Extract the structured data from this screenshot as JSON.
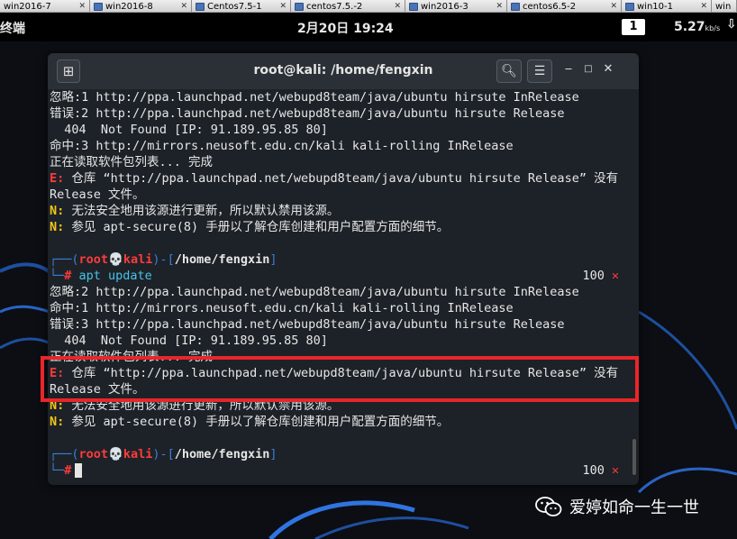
{
  "vm_tabs": [
    {
      "label": "win2016-7"
    },
    {
      "label": "win2016-8"
    },
    {
      "label": "Centos7.5-1"
    },
    {
      "label": "centos7.5.-2"
    },
    {
      "label": "win2016-3"
    },
    {
      "label": "centos6.5-2"
    },
    {
      "label": "win10-1"
    },
    {
      "label": "win"
    }
  ],
  "topbar": {
    "app_name": "终端",
    "clock": "2月20日 19:24",
    "workspace": "1",
    "net_speed": "5.27",
    "net_unit": "kb/s"
  },
  "terminal": {
    "title": "root@kali: /home/fengxin",
    "icons": {
      "new_tab": "plus-box-icon",
      "search": "search-icon",
      "menu": "hamburger-menu-icon",
      "minimize": "minimize-icon",
      "maximize": "maximize-icon",
      "close": "close-icon"
    },
    "block1": {
      "l1": "忽略:1 http://ppa.launchpad.net/webupd8team/java/ubuntu hirsute InRelease",
      "l2": "错误:2 http://ppa.launchpad.net/webupd8team/java/ubuntu hirsute Release",
      "l3": "  404  Not Found [IP: 91.189.95.85 80]",
      "l4": "命中:3 http://mirrors.neusoft.edu.cn/kali kali-rolling InRelease",
      "l5": "正在读取软件包列表... 完成",
      "l6_prefix": "E:",
      "l6": " 仓库 “http://ppa.launchpad.net/webupd8team/java/ubuntu hirsute Release” 没有",
      "l7": "Release 文件。",
      "l8_prefix": "N:",
      "l8": " 无法安全地用该源进行更新，所以默认禁用该源。",
      "l9_prefix": "N:",
      "l9": " 参见 apt-secure(8) 手册以了解仓库创建和用户配置方面的细节。"
    },
    "prompt1": {
      "open": "┌──(",
      "user": "root💀kali",
      "mid": ")-[",
      "path": "/home/fengxin",
      "close": "]",
      "arrow": "└─",
      "hash": "#",
      "command": " apt update",
      "status_code": "100",
      "status_mark": "✕"
    },
    "block2": {
      "l1": "忽略:2 http://ppa.launchpad.net/webupd8team/java/ubuntu hirsute InRelease",
      "l2": "命中:1 http://mirrors.neusoft.edu.cn/kali kali-rolling InRelease",
      "l3": "错误:3 http://ppa.launchpad.net/webupd8team/java/ubuntu hirsute Release",
      "l4": "  404  Not Found [IP: 91.189.95.85 80]",
      "l5": "正在读取软件包列表... 完成",
      "l6_prefix": "E:",
      "l6": " 仓库 “http://ppa.launchpad.net/webupd8team/java/ubuntu hirsute Release” 没有",
      "l7": "Release 文件。",
      "l8_prefix": "N:",
      "l8": " 无法安全地用该源进行更新，所以默认禁用该源。",
      "l9_prefix": "N:",
      "l9": " 参见 apt-secure(8) 手册以了解仓库创建和用户配置方面的细节。"
    },
    "prompt2": {
      "open": "┌──(",
      "user": "root💀kali",
      "mid": ")-[",
      "path": "/home/fengxin",
      "close": "]",
      "arrow": "└─",
      "hash": "#",
      "status_code": "100",
      "status_mark": "✕"
    }
  },
  "watermark": {
    "text": "爱婷如命一生一世",
    "icon": "wechat-icon"
  },
  "colors": {
    "highlight_box": "#e8262a",
    "error_prefix": "#ff3b3b",
    "notice_prefix": "#f5c518",
    "prompt_line": "#3b7dd8",
    "command": "#47c4e8",
    "terminal_bg": "#1d2228"
  }
}
